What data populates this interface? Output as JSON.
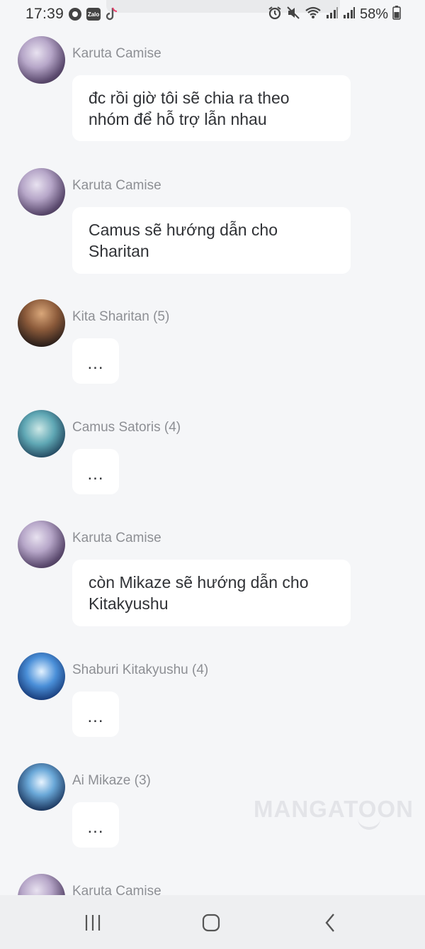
{
  "status_bar": {
    "time": "17:39",
    "battery": "58%",
    "notification_icons": [
      "messenger-icon",
      "zalo-icon",
      "tiktok-icon"
    ],
    "zalo_label": "Zalo",
    "system_icons": [
      "alarm-icon",
      "mute-icon",
      "wifi-icon",
      "signal-icon",
      "signal-icon",
      "battery-icon"
    ]
  },
  "messages": [
    {
      "sender": "Karuta Camise",
      "text": "đc rồi giờ tôi sẽ chia ra theo nhóm để hỗ trợ lẫn nhau"
    },
    {
      "sender": "Karuta Camise",
      "text": "Camus sẽ hướng dẫn cho Sharitan"
    },
    {
      "sender": "Kita Sharitan (5)",
      "text": "..."
    },
    {
      "sender": "Camus Satoris (4)",
      "text": "..."
    },
    {
      "sender": "Karuta Camise",
      "text": "còn Mikaze sẽ hướng dẫn cho Kitakyushu"
    },
    {
      "sender": "Shaburi Kitakyushu (4)",
      "text": "..."
    },
    {
      "sender": "Ai Mikaze (3)",
      "text": "..."
    },
    {
      "sender": "Karuta Camise",
      "text": ""
    }
  ],
  "watermark": "MANGATOON",
  "nav_bar": {
    "buttons": [
      "recent-apps",
      "home",
      "back"
    ]
  }
}
